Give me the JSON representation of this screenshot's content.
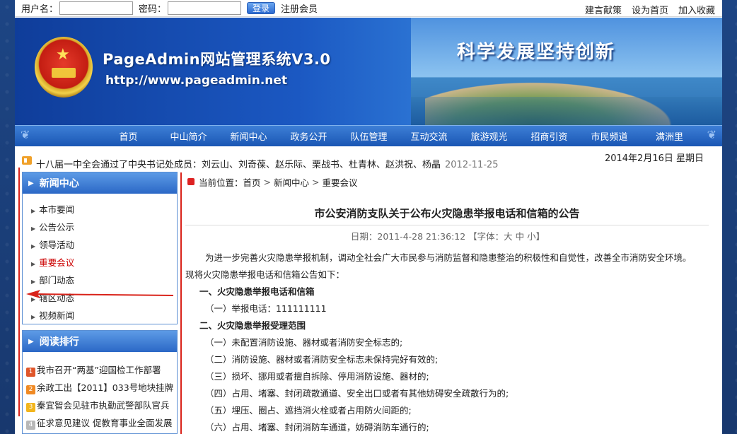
{
  "topbar": {
    "username_label": "用户名：",
    "password_label": "密码：",
    "login_label": "登录",
    "register_label": "注册会员",
    "links": [
      "建言献策",
      "设为首页",
      "加入收藏"
    ]
  },
  "banner": {
    "title": "PageAdmin网站管理系统V3.0",
    "url": "http://www.pageadmin.net",
    "slogan": "科学发展坚持创新"
  },
  "nav": [
    "首页",
    "中山简介",
    "新闻中心",
    "政务公开",
    "队伍管理",
    "互动交流",
    "旅游观光",
    "招商引资",
    "市民频道",
    "满洲里"
  ],
  "ticker": {
    "text": "十八届一中全会通过了中央书记处成员：刘云山、刘奇葆、赵乐际、栗战书、杜青林、赵洪祝、杨晶",
    "date": "2012-11-25",
    "today": "2014年2月16日  星期日"
  },
  "sidebar": {
    "news_title": "新闻中心",
    "news_items": [
      "本市要闻",
      "公告公示",
      "领导活动",
      "重要会议",
      "部门动态",
      "辖区动态",
      "视频新闻"
    ],
    "rank_title": "阅读排行",
    "rank_items": [
      {
        "num": "1",
        "text": "我市召开“两基”迎国检工作部署",
        "color": "#e0562a"
      },
      {
        "num": "2",
        "text": "余政工出【2011】033号地块挂牌",
        "color": "#f08a24"
      },
      {
        "num": "3",
        "text": "秦宜智会见驻市执勤武警部队官兵",
        "color": "#f2b51d"
      },
      {
        "num": "4",
        "text": "征求意见建议 促教育事业全面发展",
        "color": "#b8b8b8"
      }
    ]
  },
  "main": {
    "breadcrumb_label": "当前位置：",
    "breadcrumb": [
      "首页",
      "新闻中心",
      "重要会议"
    ],
    "title": "市公安消防支队关于公布火灾隐患举报电话和信箱的公告",
    "meta": "日期：2011-4-28 21:36:12  【字体：大 中 小】",
    "body": [
      {
        "cls": "ind2",
        "text": "为进一步完善火灾隐患举报机制，调动全社会广大市民参与消防监督和隐患整治的积极性和自觉性，改善全市消防安全环境。"
      },
      {
        "cls": "",
        "text": "现将火灾隐患举报电话和信箱公告如下："
      },
      {
        "cls": "ind1 h",
        "text": "一、火灾隐患举报电话和信箱"
      },
      {
        "cls": "ind2",
        "text": "（一）举报电话：111111111"
      },
      {
        "cls": "ind1 h",
        "text": "二、火灾隐患举报受理范围"
      },
      {
        "cls": "ind2",
        "text": "（一）未配置消防设施、器材或者消防安全标志的;"
      },
      {
        "cls": "ind2",
        "text": "（二）消防设施、器材或者消防安全标志未保持完好有效的;"
      },
      {
        "cls": "ind2",
        "text": "（三）损坏、挪用或者擅自拆除、停用消防设施、器材的;"
      },
      {
        "cls": "ind2",
        "text": "（四）占用、堵塞、封闭疏散通道、安全出口或者有其他妨碍安全疏散行为的;"
      },
      {
        "cls": "ind2",
        "text": "（五）埋压、圈占、遮挡消火栓或者占用防火间距的;"
      },
      {
        "cls": "ind2",
        "text": "（六）占用、堵塞、封闭消防车通道，妨碍消防车通行的;"
      }
    ]
  }
}
